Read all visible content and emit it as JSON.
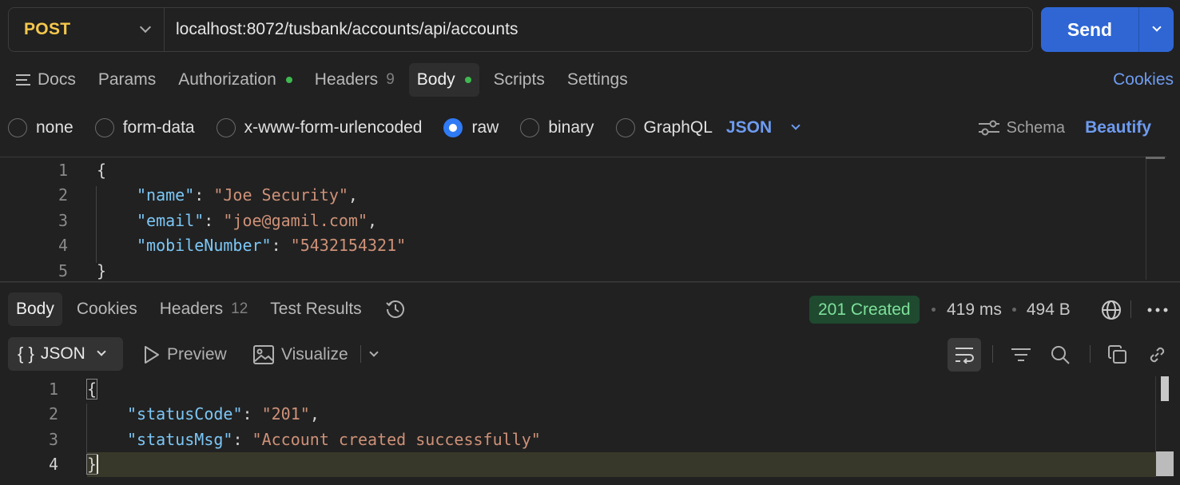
{
  "request": {
    "method": "POST",
    "url": "localhost:8072/tusbank/accounts/api/accounts",
    "send_label": "Send"
  },
  "req_tabs": {
    "docs": "Docs",
    "params": "Params",
    "authorization": "Authorization",
    "headers": "Headers",
    "headers_count": "9",
    "body": "Body",
    "scripts": "Scripts",
    "settings": "Settings",
    "cookies": "Cookies"
  },
  "body_types": {
    "none": "none",
    "form_data": "form-data",
    "urlencoded": "x-www-form-urlencoded",
    "raw": "raw",
    "binary": "binary",
    "graphql": "GraphQL",
    "selected": "raw",
    "language": "JSON",
    "schema": "Schema",
    "beautify": "Beautify"
  },
  "request_body": {
    "line_numbers": [
      "1",
      "2",
      "3",
      "4",
      "5"
    ],
    "open_brace": "{",
    "close_brace": "}",
    "fields": [
      {
        "key": "\"name\"",
        "value": "\"Joe Security\"",
        "trail": ","
      },
      {
        "key": "\"email\"",
        "value": "\"joe@gamil.com\"",
        "trail": ","
      },
      {
        "key": "\"mobileNumber\"",
        "value": "\"5432154321\"",
        "trail": ""
      }
    ]
  },
  "response": {
    "tabs": {
      "body": "Body",
      "cookies": "Cookies",
      "headers": "Headers",
      "headers_count": "12",
      "test_results": "Test Results"
    },
    "status": "201 Created",
    "time": "419 ms",
    "size": "494 B",
    "format": "JSON",
    "preview": "Preview",
    "visualize": "Visualize",
    "line_numbers": [
      "1",
      "2",
      "3",
      "4"
    ],
    "open_brace": "{",
    "close_brace": "}",
    "fields": [
      {
        "key": "\"statusCode\"",
        "value": "\"201\"",
        "trail": ","
      },
      {
        "key": "\"statusMsg\"",
        "value": "\"Account created successfully\"",
        "trail": ""
      }
    ]
  },
  "colors": {
    "send": "#2f66d4",
    "method": "#f5c84c",
    "link": "#6e9bf0",
    "status_bg": "#1f4a2f",
    "status_text": "#7ee09b"
  }
}
